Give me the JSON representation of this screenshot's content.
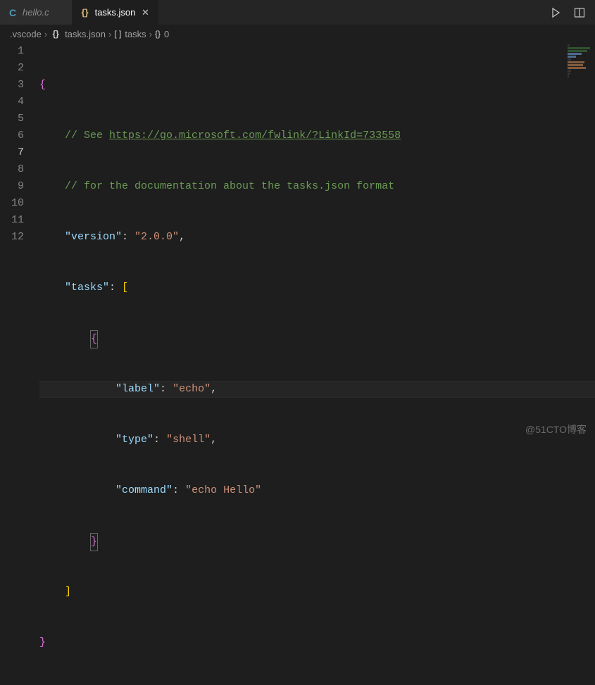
{
  "tabs": [
    {
      "icon": "C",
      "label": "hello.c",
      "active": false
    },
    {
      "icon": "{}",
      "label": "tasks.json",
      "active": true
    }
  ],
  "breadcrumbs": {
    "parts": [
      {
        "icon": "",
        "label": ".vscode"
      },
      {
        "icon": "{}",
        "label": "tasks.json"
      },
      {
        "icon": "[ ]",
        "label": "tasks"
      },
      {
        "icon": "{}",
        "label": "0"
      }
    ]
  },
  "code": {
    "active_line": 7,
    "comment1_prefix": "// See ",
    "comment1_url": "https://go.microsoft.com/fwlink/?LinkId=733558",
    "comment2": "// for the documentation about the tasks.json format",
    "k_version": "\"version\"",
    "v_version": "\"2.0.0\"",
    "k_tasks": "\"tasks\"",
    "k_label": "\"label\"",
    "v_label": "\"echo\"",
    "k_type": "\"type\"",
    "v_type": "\"shell\"",
    "k_command": "\"command\"",
    "v_command": "\"echo Hello\""
  },
  "line_numbers": [
    "1",
    "2",
    "3",
    "4",
    "5",
    "6",
    "7",
    "8",
    "9",
    "10",
    "11",
    "12"
  ],
  "watermark": "@51CTO博客"
}
